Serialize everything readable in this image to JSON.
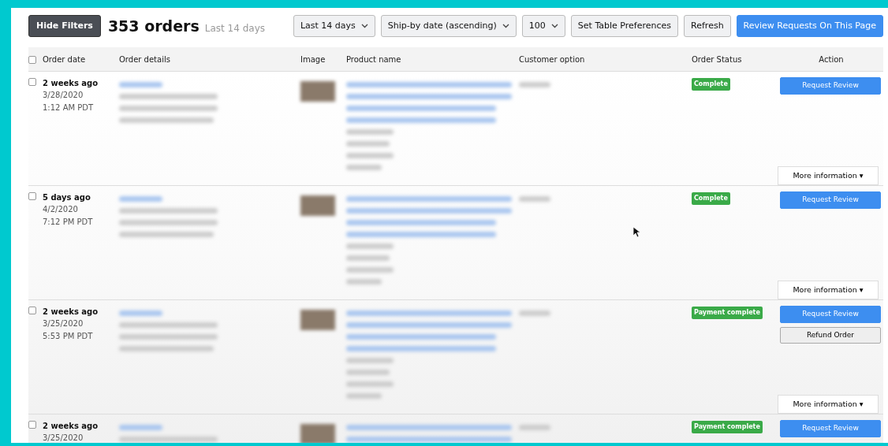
{
  "toolbar": {
    "hide_filters": "Hide Filters",
    "title": "353 orders",
    "subtitle": "Last 14 days",
    "dropdowns": [
      {
        "label": "Last 14 days"
      },
      {
        "label": "Ship-by date (ascending)"
      },
      {
        "label": "100"
      }
    ],
    "buttons": [
      {
        "label": "Set Table Preferences",
        "kind": "plain"
      },
      {
        "label": "Refresh",
        "kind": "plain"
      },
      {
        "label": "Review Requests On This Page",
        "kind": "primary"
      }
    ]
  },
  "table": {
    "select_all_checked": false,
    "columns": [
      "Order date",
      "Order details",
      "Image",
      "Product name",
      "Customer option",
      "Order Status",
      "Action"
    ],
    "rows": [
      {
        "checked": false,
        "relative": "2 weeks ago",
        "date": "3/28/2020",
        "time": "1:12 AM PDT",
        "status": "Complete",
        "actions": [
          {
            "label": "Request Review",
            "kind": "primary"
          }
        ],
        "more": "More information ▾"
      },
      {
        "checked": false,
        "relative": "5 days ago",
        "date": "4/2/2020",
        "time": "7:12 PM PDT",
        "status": "Complete",
        "actions": [
          {
            "label": "Request Review",
            "kind": "primary"
          }
        ],
        "more": "More information ▾"
      },
      {
        "checked": false,
        "relative": "2 weeks ago",
        "date": "3/25/2020",
        "time": "5:53 PM PDT",
        "status": "Payment complete",
        "actions": [
          {
            "label": "Request Review",
            "kind": "primary"
          },
          {
            "label": "Refund Order",
            "kind": "plain"
          }
        ],
        "more": "More information ▾"
      },
      {
        "checked": false,
        "relative": "2 weeks ago",
        "date": "3/25/2020",
        "status": "Payment complete",
        "actions": [
          {
            "label": "Request Review",
            "kind": "primary"
          }
        ]
      }
    ]
  }
}
